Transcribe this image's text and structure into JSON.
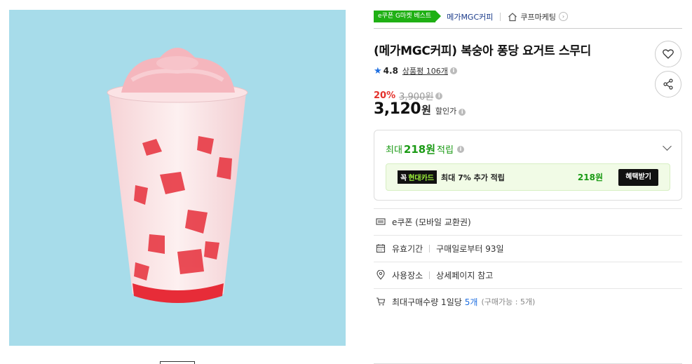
{
  "header": {
    "badge": "e쿠폰 G마켓 베스트",
    "brand": "메가MGC커피",
    "shop": "쿠프마케팅"
  },
  "product": {
    "title": "(메가MGC커피) 복숭아 퐁당 요거트 스무디",
    "rating": "4.8",
    "review_link": "상품평 106개",
    "discount_rate": "20%",
    "original_price": "3,900원",
    "price": "3,120",
    "price_unit": "원",
    "price_label": "할인가"
  },
  "points": {
    "prefix": "최대",
    "amount": "218원",
    "suffix": "적립",
    "card_badge_prefix": "꼭",
    "card_badge_name": "현대카드",
    "card_text": "최대 7% 추가 적립",
    "card_points": "218원",
    "card_button": "혜택받기"
  },
  "details": [
    {
      "label": "e쿠폰 (모바일 교환권)",
      "icon": "ticket-icon"
    },
    {
      "label": "유효기간",
      "value": "구매일로부터 93일",
      "icon": "calendar-icon"
    },
    {
      "label": "사용장소",
      "value": "상세페이지 참고",
      "icon": "location-icon"
    },
    {
      "label": "최대구매수량 1일당",
      "highlight": "5개",
      "sub": "(구매가능 : 5개)",
      "icon": "cart-icon"
    }
  ],
  "colors": {
    "accent_green": "#1fb014",
    "discount_red": "#e4312b",
    "link_blue": "#1f6fe0",
    "image_bg": "#a7dcea"
  }
}
